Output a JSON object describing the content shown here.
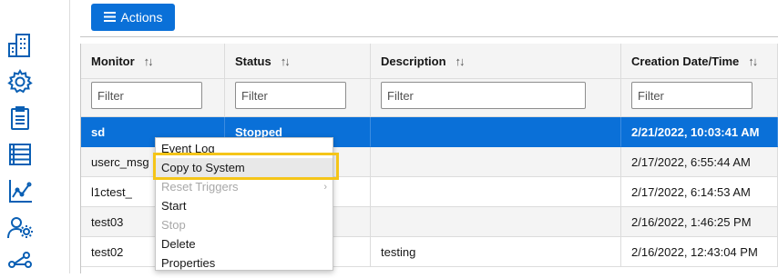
{
  "toolbar": {
    "actions_label": "Actions"
  },
  "table": {
    "columns": [
      {
        "label": "Monitor",
        "filter_placeholder": "Filter"
      },
      {
        "label": "Status",
        "filter_placeholder": "Filter"
      },
      {
        "label": "Description",
        "filter_placeholder": "Filter"
      },
      {
        "label": "Creation Date/Time",
        "filter_placeholder": "Filter"
      }
    ],
    "rows": [
      {
        "monitor": "sd",
        "status": "Stopped",
        "description": "",
        "created": "2/21/2022, 10:03:41 AM"
      },
      {
        "monitor": "userc_msg",
        "status": "",
        "description": "",
        "created": "2/17/2022, 6:55:44 AM"
      },
      {
        "monitor": "l1ctest_",
        "status": "",
        "description": "",
        "created": "2/17/2022, 6:14:53 AM"
      },
      {
        "monitor": "test03",
        "status": "",
        "description": "",
        "created": "2/16/2022, 1:46:25 PM"
      },
      {
        "monitor": "test02",
        "status": "",
        "description": "testing",
        "created": "2/16/2022, 12:43:04 PM"
      }
    ]
  },
  "context_menu": {
    "items": [
      {
        "label": "Event Log",
        "disabled": false
      },
      {
        "label": "Copy to System",
        "disabled": false
      },
      {
        "label": "Reset Triggers",
        "disabled": true
      },
      {
        "label": "Start",
        "disabled": false
      },
      {
        "label": "Stop",
        "disabled": true
      },
      {
        "label": "Delete",
        "disabled": false
      },
      {
        "label": "Properties",
        "disabled": false
      }
    ]
  },
  "colors": {
    "accent": "#0a70d8",
    "highlight": "#f5c518",
    "icon": "#0a5fb4"
  },
  "sidebar_icons": [
    "building-icon",
    "gear-icon",
    "clipboard-icon",
    "server-list-icon",
    "line-chart-icon",
    "user-gear-icon",
    "network-icon"
  ]
}
